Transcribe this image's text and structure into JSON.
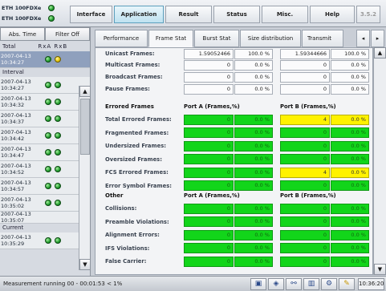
{
  "ports": [
    {
      "label": "ETH 100FDXe",
      "status": "green"
    },
    {
      "label": "ETH 100FDXe",
      "status": "green"
    }
  ],
  "top_tabs": [
    "Interface",
    "Application",
    "Result",
    "Status",
    "Misc.",
    "Help",
    "3.5.2"
  ],
  "left": {
    "abs_time_btn": "Abs. Time",
    "filter_btn": "Filter Off",
    "total_label": "Total",
    "rx_label": "RxA RxB",
    "total_entry": {
      "date": "2007-04-13",
      "time": "10:34:27"
    },
    "interval_label": "Interval",
    "intervals": [
      {
        "date": "2007-04-13",
        "time": "10:34:27"
      },
      {
        "date": "2007-04-13",
        "time": "10:34:32"
      },
      {
        "date": "2007-04-13",
        "time": "10:34:37"
      },
      {
        "date": "2007-04-13",
        "time": "10:34:42"
      },
      {
        "date": "2007-04-13",
        "time": "10:34:47"
      },
      {
        "date": "2007-04-13",
        "time": "10:34:52"
      },
      {
        "date": "2007-04-13",
        "time": "10:34:57"
      },
      {
        "date": "2007-04-13",
        "time": "10:35:02"
      },
      {
        "date": "2007-04-13",
        "time": "10:35:07"
      }
    ],
    "current_label": "Current",
    "current_entry": {
      "date": "2007-04-13",
      "time": "10:35:29"
    }
  },
  "main_tabs": [
    "Performance",
    "Frame Stat",
    "Burst Stat",
    "Size distribution",
    "Transmit"
  ],
  "top_rows": [
    {
      "label": "Unicast Frames:",
      "a_count": "1.59052466",
      "a_pct": "100.0 %",
      "b_count": "1.59344666",
      "b_pct": "100.0 %"
    },
    {
      "label": "Multicast Frames:",
      "a_count": "0",
      "a_pct": "0.0 %",
      "b_count": "0",
      "b_pct": "0.0 %"
    },
    {
      "label": "Broadcast Frames:",
      "a_count": "0",
      "a_pct": "0.0 %",
      "b_count": "0",
      "b_pct": "0.0 %"
    },
    {
      "label": "Pause Frames:",
      "a_count": "0",
      "a_pct": "0.0 %",
      "b_count": "0",
      "b_pct": "0.0 %"
    }
  ],
  "errored": {
    "title": "Errored Frames",
    "port_a": "Port A (Frames,%)",
    "port_b": "Port B (Frames,%)",
    "rows": [
      {
        "label": "Total Errored Frames:",
        "a_count": "0",
        "a_pct": "0.0 %",
        "b_count": "4",
        "b_pct": "0.0 %",
        "b_warn": true
      },
      {
        "label": "Fragmented Frames:",
        "a_count": "0",
        "a_pct": "0.0 %",
        "b_count": "0",
        "b_pct": "0.0 %",
        "b_warn": false
      },
      {
        "label": "Undersized Frames:",
        "a_count": "0",
        "a_pct": "0.0 %",
        "b_count": "0",
        "b_pct": "0.0 %",
        "b_warn": false
      },
      {
        "label": "Oversized Frames:",
        "a_count": "0",
        "a_pct": "0.0 %",
        "b_count": "0",
        "b_pct": "0.0 %",
        "b_warn": false
      },
      {
        "label": "FCS Errored Frames:",
        "a_count": "0",
        "a_pct": "0.0 %",
        "b_count": "4",
        "b_pct": "0.0 %",
        "b_warn": true
      },
      {
        "label": "Error Symbol Frames:",
        "a_count": "0",
        "a_pct": "0.0 %",
        "b_count": "0",
        "b_pct": "0.0 %",
        "b_warn": false
      }
    ]
  },
  "other": {
    "title": "Other",
    "port_a": "Port A (Frames,%)",
    "port_b": "Port B (Frames,%)",
    "rows": [
      {
        "label": "Collisions:",
        "a_count": "0",
        "a_pct": "0.0 %",
        "b_count": "0",
        "b_pct": "0.0 %"
      },
      {
        "label": "Preamble Violations:",
        "a_count": "0",
        "a_pct": "0.0 %",
        "b_count": "0",
        "b_pct": "0.0 %"
      },
      {
        "label": "Alignment Errors:",
        "a_count": "0",
        "a_pct": "0.0 %",
        "b_count": "0",
        "b_pct": "0.0 %"
      },
      {
        "label": "IFS Violations:",
        "a_count": "0",
        "a_pct": "0.0 %",
        "b_count": "0",
        "b_pct": "0.0 %"
      },
      {
        "label": "False Carrier:",
        "a_count": "0",
        "a_pct": "0.0 %",
        "b_count": "0",
        "b_pct": "0.0 %"
      }
    ]
  },
  "status": {
    "message": "Measurement running 00 - 00:01:53 < 1%",
    "clock": "10:36:20",
    "icons": [
      "window-icon",
      "diamond-icon",
      "network-icon",
      "bar-chart-icon",
      "settings-icon",
      "wrench-icon"
    ]
  },
  "colors": {
    "ok_green": "#12d51a",
    "warn_yellow": "#fff200",
    "active_tab": "#bfe2f0"
  }
}
